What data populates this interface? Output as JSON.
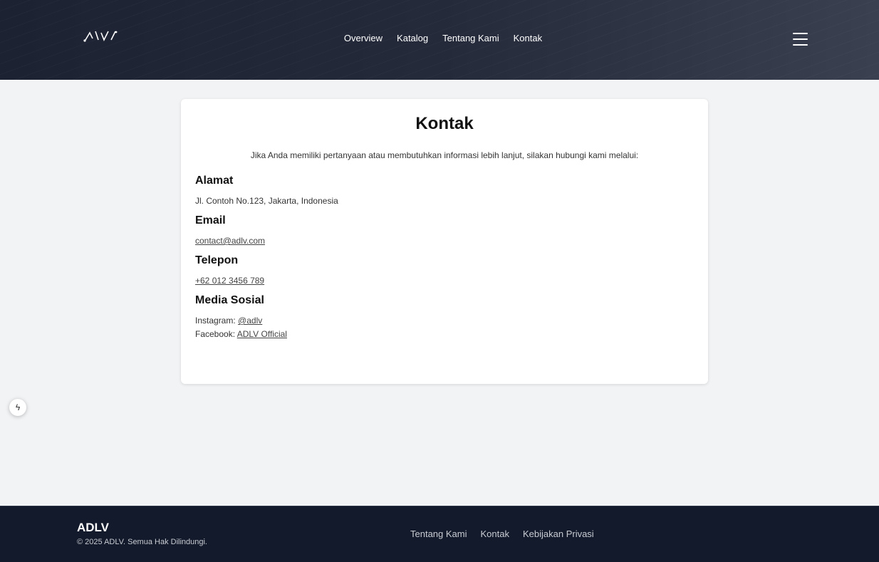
{
  "header": {
    "logo_text": "ADLV",
    "nav": [
      "Overview",
      "Katalog",
      "Tentang Kami",
      "Kontak"
    ]
  },
  "contact": {
    "title": "Kontak",
    "intro": "Jika Anda memiliki pertanyaan atau membutuhkan informasi lebih lanjut, silakan hubungi kami melalui:",
    "address_title": "Alamat",
    "address": "Jl. Contoh No.123, Jakarta, Indonesia",
    "email_title": "Email",
    "email": "contact@adlv.com",
    "phone_title": "Telepon",
    "phone": "+62 012 3456 789",
    "social_title": "Media Sosial",
    "instagram_label": "Instagram:",
    "instagram": "@adlv",
    "facebook_label": "Facebook:",
    "facebook": "ADLV Official"
  },
  "side_button": {
    "icon": "bolt-icon",
    "glyph": "ϟ"
  },
  "footer": {
    "brand": "ADLV",
    "copyright": "© 2025 ADLV. Semua Hak Dilindungi.",
    "links": [
      "Tentang Kami",
      "Kontak",
      "Kebijakan Privasi"
    ]
  },
  "colors": {
    "header_bg": "#1c2232",
    "page_bg": "#f2f3f5",
    "footer_bg": "#131a2b"
  }
}
